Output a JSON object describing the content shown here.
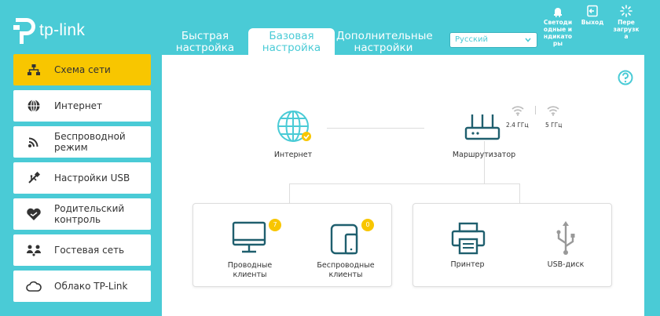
{
  "brand": {
    "name": "tp-link"
  },
  "tabs": [
    {
      "line1": "Быстрая",
      "line2": "настройка"
    },
    {
      "line1": "Базовая",
      "line2": "настройка"
    },
    {
      "line1": "Дополнительные",
      "line2": "настройки"
    }
  ],
  "language": {
    "selected": "Русский"
  },
  "tools": {
    "led": [
      "Светоди",
      "одные и",
      "ндикато",
      "ры"
    ],
    "exit": [
      "Выход"
    ],
    "reboot": [
      "Пере",
      "загрузк",
      "а"
    ]
  },
  "sidebar": {
    "items": [
      {
        "label": "Схема сети",
        "icon": "network-map-icon"
      },
      {
        "label": "Интернет",
        "icon": "globe-icon"
      },
      {
        "label": "Беспроводной режим",
        "icon": "wireless-icon"
      },
      {
        "label": "Настройки USB",
        "icon": "usb-icon"
      },
      {
        "label": "Родительский контроль",
        "icon": "heart-icon"
      },
      {
        "label": "Гостевая сеть",
        "icon": "guest-icon"
      },
      {
        "label": "Облако TP-Link",
        "icon": "cloud-icon"
      }
    ]
  },
  "map": {
    "internet_label": "Интернет",
    "router_label": "Маршрутизатор",
    "freq_24": "2.4 ГГц",
    "freq_5": "5 ГГц",
    "wired_clients": {
      "line1": "Проводные",
      "line2": "клиенты",
      "count": "7"
    },
    "wireless_clients": {
      "line1": "Беспроводные",
      "line2": "клиенты",
      "count": "0"
    },
    "printer_label": "Принтер",
    "usb_disk_label": "USB-диск"
  },
  "colors": {
    "accent": "#4acbd6",
    "active": "#f8c600",
    "icon": "#1f5f6e"
  }
}
